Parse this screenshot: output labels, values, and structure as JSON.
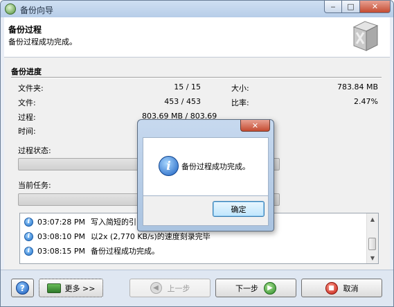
{
  "window": {
    "title": "备份向导",
    "controls": {
      "minimize": "‒",
      "maximize": "□",
      "close": "✕"
    }
  },
  "header": {
    "title": "备份过程",
    "subtitle": "备份过程成功完成。"
  },
  "progress_section": {
    "title": "备份进度",
    "folders_label": "文件夹:",
    "folders_value": "15 / 15",
    "files_label": "文件:",
    "files_value": "453 / 453",
    "size_label": "大小:",
    "size_value": "783.84 MB",
    "ratio_label": "比率:",
    "ratio_value": "2.47%",
    "process_label": "过程:",
    "process_value": "803.69 MB / 803.69",
    "time_label": "时间:",
    "process_status_label": "过程状态:",
    "current_task_label": "当前任务:"
  },
  "log": {
    "entries": [
      {
        "time": "03:07:28 PM",
        "message": "写入简短的引出"
      },
      {
        "time": "03:08:10 PM",
        "message": "以2x (2,770 KB/s)的速度刻录完毕"
      },
      {
        "time": "03:08:15 PM",
        "message": "备份过程成功完成。"
      }
    ]
  },
  "buttons": {
    "help": "?",
    "more": "更多 >>",
    "prev": "上一步",
    "next": "下一步",
    "cancel": "取消"
  },
  "dialog": {
    "close": "✕",
    "message": "备份过程成功完成。",
    "ok": "确定"
  },
  "icons": {
    "info": "i",
    "prev_arrow": "◀",
    "next_arrow": "▶",
    "cancel_mark": "■",
    "scroll_up": "▲",
    "scroll_down": "▼"
  }
}
